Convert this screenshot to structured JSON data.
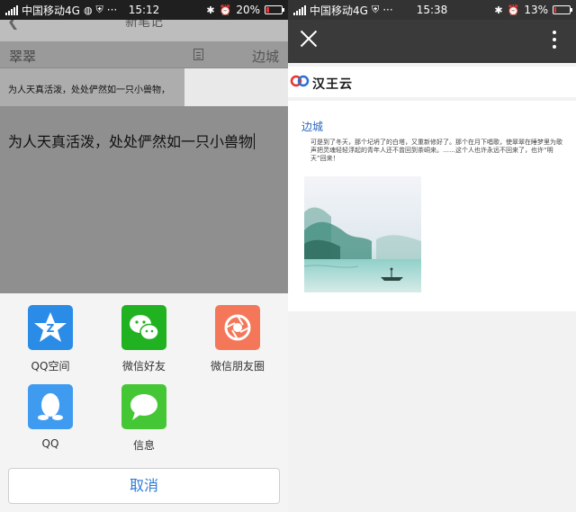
{
  "left_screen": {
    "status": {
      "carrier": "中国移动4G",
      "time": "15:12",
      "battery": "20%",
      "battery_level": 0.2
    },
    "note": {
      "header_title": "新笔记",
      "author": "翠翠",
      "place": "边城",
      "card_text": "为人天真活泼，处处俨然如一只小兽物，",
      "body_text": "为人天真活泼，处处俨然如一只小兽物"
    },
    "share": {
      "items": [
        {
          "label": "QQ空间",
          "icon": "qzone-icon",
          "color": "#2a8ce6"
        },
        {
          "label": "微信好友",
          "icon": "wechat-icon",
          "color": "#21b221"
        },
        {
          "label": "微信朋友圈",
          "icon": "moments-icon",
          "color": "#f4775a"
        },
        {
          "label": "QQ",
          "icon": "qq-icon",
          "color": "#3f9bf0"
        },
        {
          "label": "信息",
          "icon": "message-icon",
          "color": "#45c634"
        }
      ],
      "cancel_label": "取消"
    }
  },
  "right_screen": {
    "status": {
      "carrier": "中国移动4G",
      "time": "15:38",
      "battery": "13%",
      "battery_level": 0.13
    },
    "toolbar": {
      "close_icon": "close-icon",
      "more_icon": "more-vertical-icon"
    },
    "brand": {
      "name": "汉王云"
    },
    "article": {
      "title": "边城",
      "body": "可是到了冬天，那个圮坍了的白塔，又重新修好了。那个在月下唱歌，使翠翠在睡梦里为歌声把灵魂轻轻浮起的青年人还不曾回到茶峒来。……这个人也许永远不回来了，也许“明天”回来！"
    }
  }
}
